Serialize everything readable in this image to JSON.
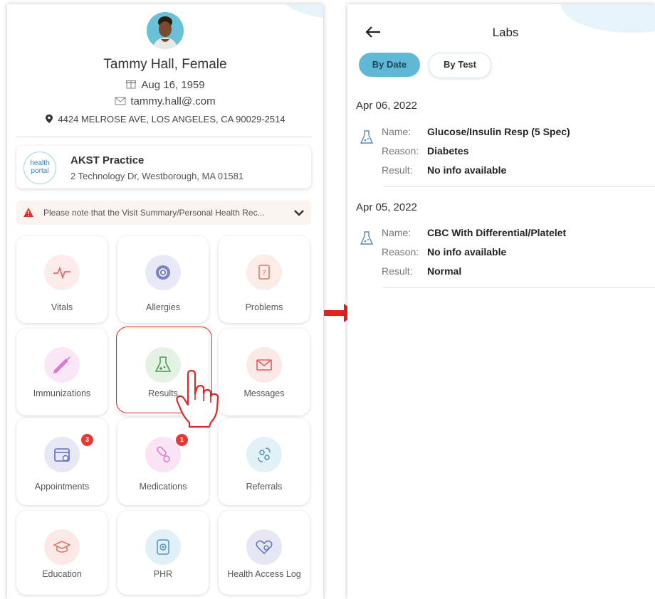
{
  "profile": {
    "name": "Tammy Hall, Female",
    "dob": "Aug 16, 1959",
    "email": "tammy.hall@.com",
    "address": "4424 MELROSE AVE, LOS ANGELES, CA 90029-2514"
  },
  "practice": {
    "logo_text_1": "health",
    "logo_text_2": "portal",
    "name": "AKST Practice",
    "address": "2 Technology Dr, Westborough, MA 01581"
  },
  "notice": {
    "text": "Please note that the Visit Summary/Personal Health Rec..."
  },
  "tiles": [
    {
      "label": "Vitals",
      "icon": "heartbeat-icon"
    },
    {
      "label": "Allergies",
      "icon": "allergy-icon"
    },
    {
      "label": "Problems",
      "icon": "document-icon"
    },
    {
      "label": "Immunizations",
      "icon": "syringe-icon"
    },
    {
      "label": "Results",
      "icon": "flask-icon"
    },
    {
      "label": "Messages",
      "icon": "envelope-icon"
    },
    {
      "label": "Appointments",
      "icon": "calendar-icon",
      "badge": "3"
    },
    {
      "label": "Medications",
      "icon": "pills-icon",
      "badge": "1"
    },
    {
      "label": "Referrals",
      "icon": "referral-icon"
    },
    {
      "label": "Education",
      "icon": "graduation-cap-icon"
    },
    {
      "label": "PHR",
      "icon": "phr-icon"
    },
    {
      "label": "Health Access Log",
      "icon": "heart-search-icon"
    }
  ],
  "labs": {
    "title": "Labs",
    "tab_by_date": "By Date",
    "tab_by_test": "By Test",
    "name_label": "Name:",
    "reason_label": "Reason:",
    "result_label": "Result:",
    "entries": [
      {
        "date": "Apr 06, 2022",
        "name": "Glucose/Insulin Resp (5 Spec)",
        "reason": "Diabetes",
        "result": "No info available"
      },
      {
        "date": "Apr 05, 2022",
        "name": "CBC With Differential/Platelet",
        "reason": "No info available",
        "result": "Normal"
      }
    ]
  },
  "colors": {
    "accent": "#5fb9d6",
    "highlight": "#d9292b",
    "arrow": "#e32020"
  }
}
